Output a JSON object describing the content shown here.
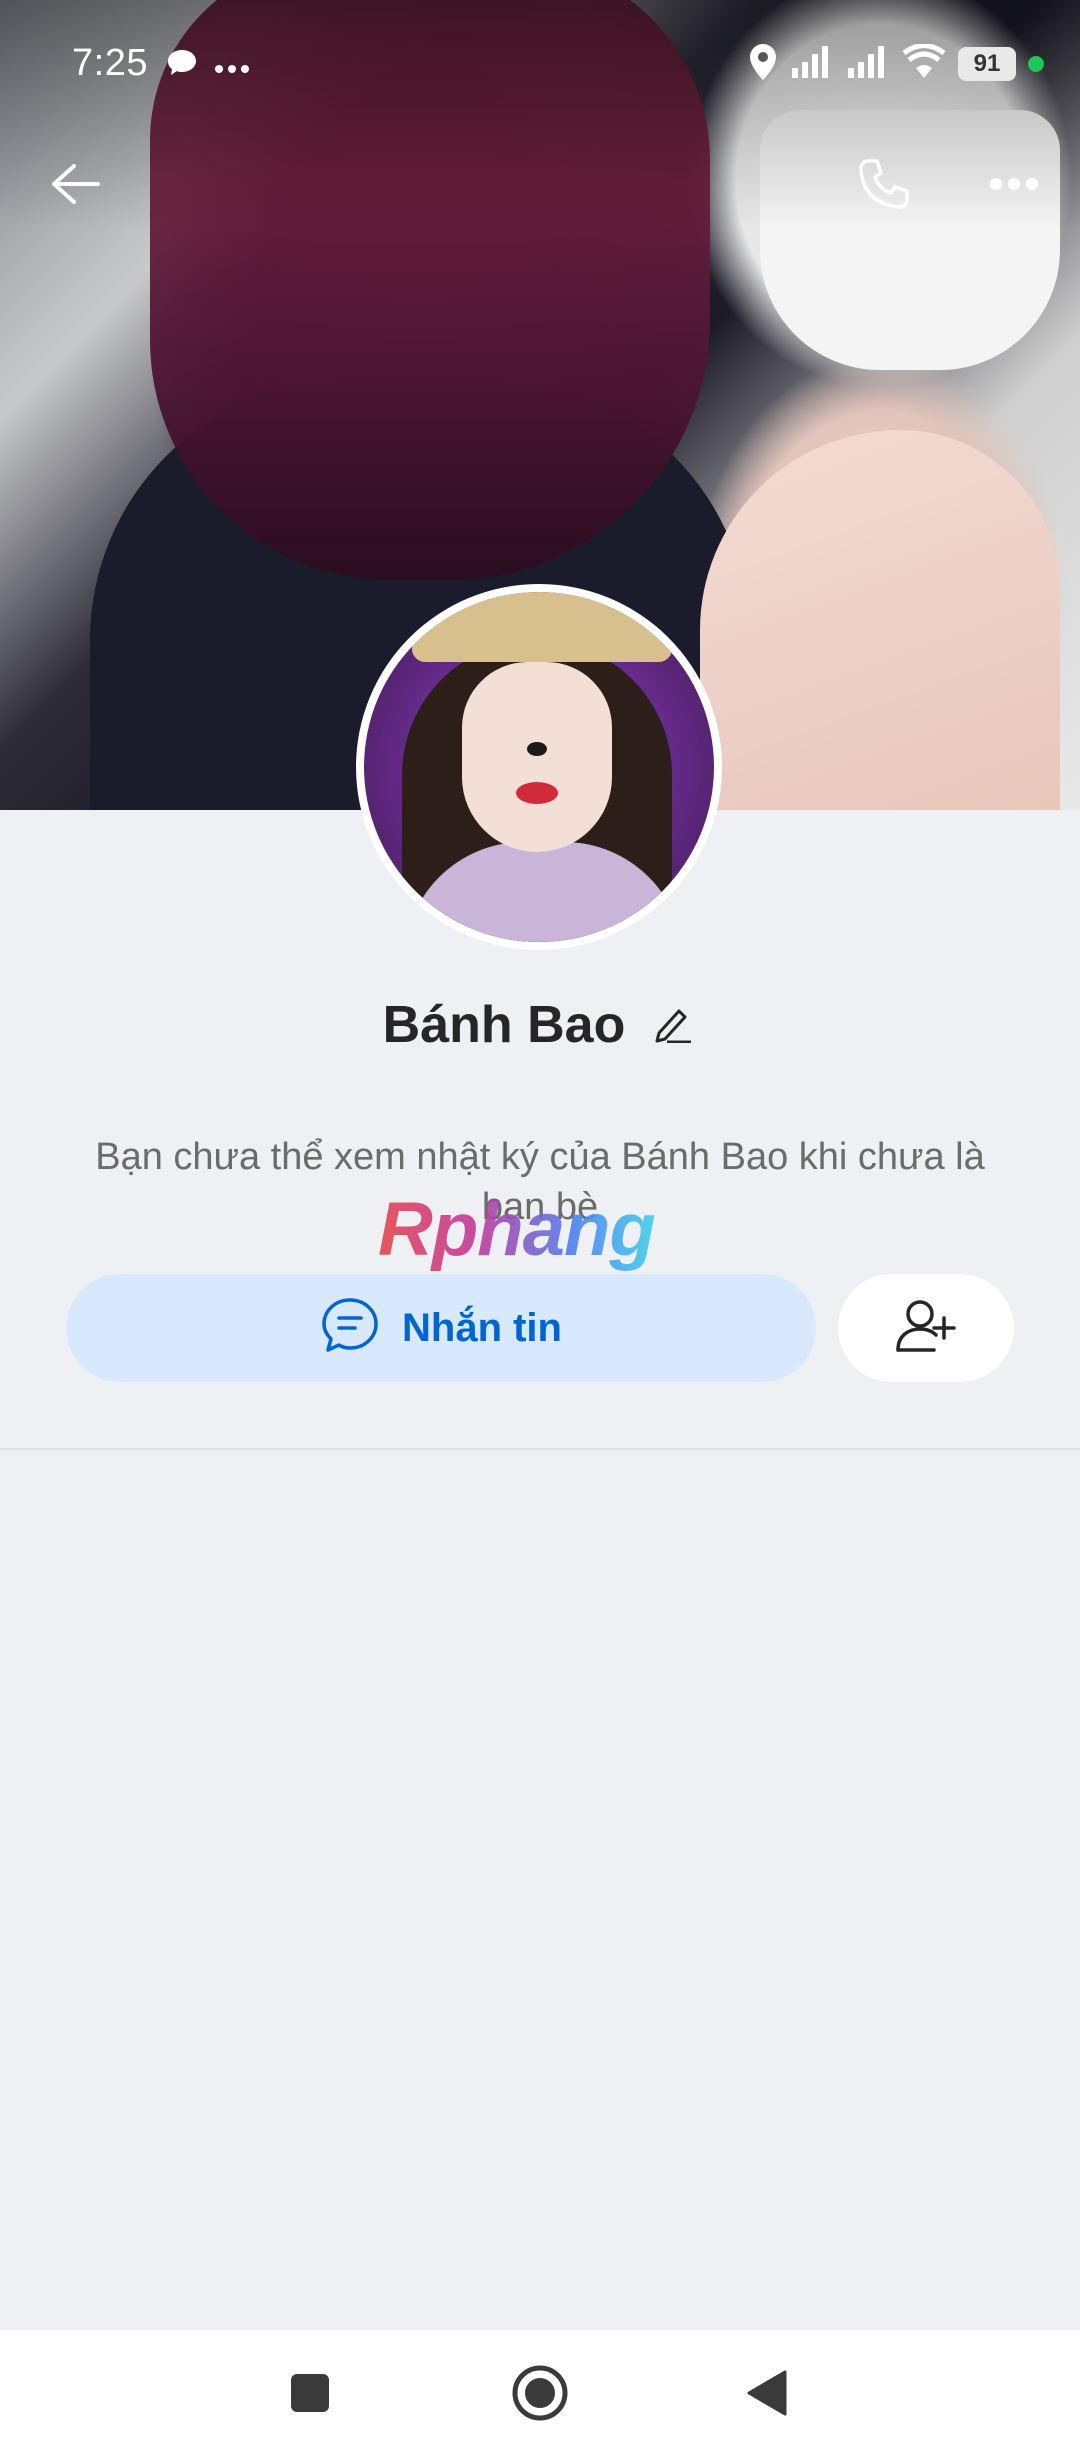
{
  "status_bar": {
    "time": "7:25",
    "battery": "91",
    "icons": [
      "chat-bubble-icon",
      "more-dots-icon",
      "location-icon",
      "signal-icon",
      "signal-icon",
      "wifi-icon",
      "battery-icon",
      "active-dot"
    ]
  },
  "header": {
    "back_icon": "arrow-left-icon",
    "call_icon": "phone-icon",
    "menu_icon": "more-horizontal-icon"
  },
  "profile": {
    "name": "Bánh Bao",
    "edit_icon": "pencil-icon",
    "notice": "Bạn chưa thể xem nhật ký của Bánh Bao khi chưa là bạn bè"
  },
  "watermark": "Rphang",
  "actions": {
    "message_label": "Nhắn tin",
    "message_icon": "chat-icon",
    "add_friend_icon": "add-user-icon"
  },
  "colors": {
    "accent": "#0064d3",
    "message_button_bg": "#d8e9fe",
    "page_bg": "#eff0f4"
  },
  "navigation": {
    "items": [
      "recents-square-icon",
      "home-circle-icon",
      "back-triangle-icon"
    ]
  }
}
